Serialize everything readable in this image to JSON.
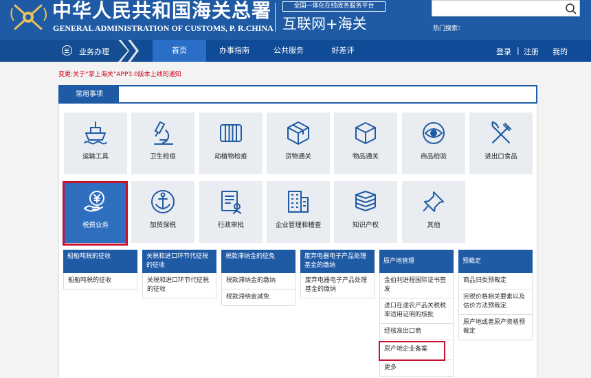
{
  "header": {
    "title_cn": "中华人民共和国海关总署",
    "title_en": "GENERAL ADMINISTRATION OF CUSTOMS, P. R.CHINA",
    "platform_tag": "全国一体化在线政务服务平台",
    "platform_name": "互联网+海关",
    "search_placeholder": "",
    "hot_search_label": "热门搜索："
  },
  "nav": {
    "business_label": "业务办理",
    "items": [
      "首页",
      "办事指南",
      "公共服务",
      "好差评"
    ],
    "active_index": 0,
    "login": "登录",
    "separator": "|",
    "register": "注册",
    "mine": "我的"
  },
  "notice": "变更:关于“掌上海关”APP3.0版本上线的通知",
  "common": {
    "label": "常用事项",
    "tiles": [
      {
        "label": "运输工具",
        "icon": "ship-icon"
      },
      {
        "label": "卫生检疫",
        "icon": "microscope-icon"
      },
      {
        "label": "动植物检疫",
        "icon": "barrel-icon"
      },
      {
        "label": "货物通关",
        "icon": "cargo-box-icon"
      },
      {
        "label": "物品通关",
        "icon": "package-cube-icon"
      },
      {
        "label": "商品检验",
        "icon": "eye-icon"
      },
      {
        "label": "进出口食品",
        "icon": "fork-knife-icon"
      },
      {
        "label": "税费业务",
        "icon": "hand-yuan-icon"
      },
      {
        "label": "加贸保税",
        "icon": "anchor-icon"
      },
      {
        "label": "行政审批",
        "icon": "approval-doc-icon"
      },
      {
        "label": "企业管理和稽查",
        "icon": "building-icon"
      },
      {
        "label": "知识产权",
        "icon": "stacked-books-icon"
      },
      {
        "label": "其他",
        "icon": "pin-icon"
      }
    ],
    "selected_index": 7
  },
  "sub_columns": [
    {
      "title": "船舶吨税的征收",
      "links": [
        "船舶吨税的征收"
      ]
    },
    {
      "title": "关税和进口环节代征税的征收",
      "links": [
        "关税和进口环节代征税的征收"
      ]
    },
    {
      "title": "税款滞纳金的征免",
      "links": [
        "税款滞纳金的缴纳",
        "税款滞纳金减免"
      ]
    },
    {
      "title": "废弃电器电子产品处理基金的缴纳",
      "links": [
        "废弃电器电子产品处理基金的缴纳"
      ]
    },
    {
      "title": "原产地管理",
      "links": [
        "金伯利进程国际证书签发",
        "进口在途农产品关税税率适用证明的核批",
        "经核准出口商",
        "原产地企业备案",
        "更多"
      ]
    },
    {
      "title": "预裁定",
      "links": [
        "商品归类预裁定",
        "完税价格相关要素以及估价方法预裁定",
        "原产地或者原产资格预裁定"
      ]
    }
  ],
  "colors": {
    "header_blue": "#1f5aa5",
    "nav_blue": "#0f4b96",
    "active_tab": "#2a6fc7",
    "highlight_red": "#c8102e",
    "notice_red": "#d0021b"
  }
}
